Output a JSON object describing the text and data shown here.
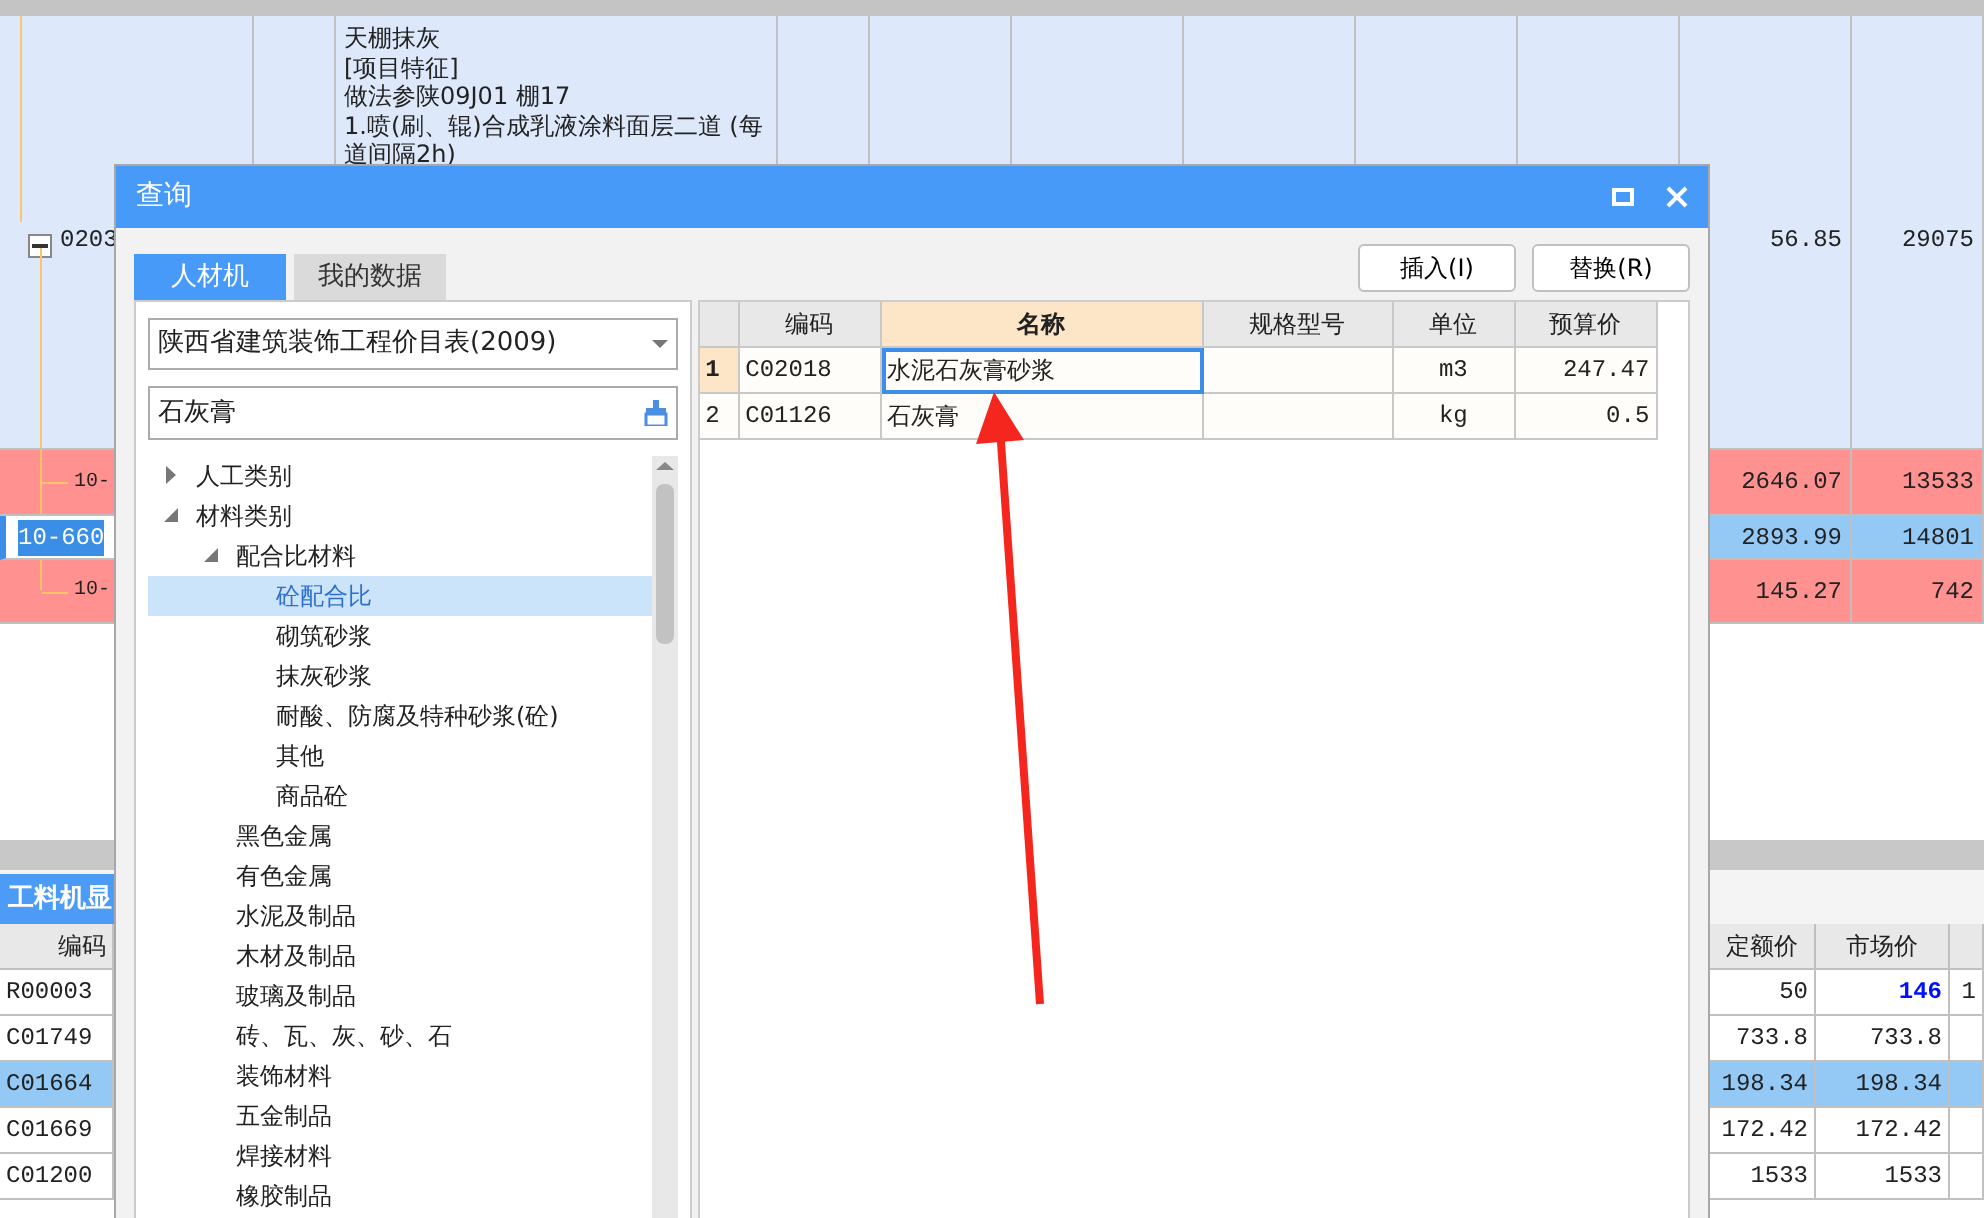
{
  "estimate_sheet": {
    "rows": [
      {
        "code": "0203",
        "expanded": true,
        "editing": false,
        "color": "#dde9fb",
        "description_lines": [
          "天棚抹灰",
          "[项目特征]",
          "做法参陕09J01 棚17",
          "1.喷(刷、辊)合成乳液涂料面层二道 (每",
          "道间隔2h)"
        ],
        "values": [
          "56.85",
          "29075"
        ]
      },
      {
        "code": "10-",
        "editing": false,
        "color": "#ff9191",
        "values": [
          "2646.07",
          "13533"
        ]
      },
      {
        "code": "10-660",
        "editing": true,
        "color": "#94c8f5",
        "values": [
          "2893.99",
          "14801"
        ]
      },
      {
        "code": "10-",
        "editing": false,
        "color": "#ff9191",
        "values": [
          "145.27",
          "742"
        ]
      }
    ]
  },
  "resource_panel": {
    "title": "工料机显",
    "columns": [
      "编码",
      "定额价",
      "市场价"
    ],
    "rows": [
      {
        "code": "R00003",
        "quota_price": "50",
        "market_price": "146",
        "column_5": "1",
        "emphasized": true,
        "selected": false
      },
      {
        "code": "C01749",
        "quota_price": "733.8",
        "market_price": "733.8",
        "emphasized": false,
        "selected": false
      },
      {
        "code": "C01664",
        "quota_price": "198.34",
        "market_price": "198.34",
        "emphasized": false,
        "selected": true
      },
      {
        "code": "C01669",
        "quota_price": "172.42",
        "market_price": "172.42",
        "emphasized": false,
        "selected": false
      },
      {
        "code": "C01200",
        "quota_price": "1533",
        "market_price": "1533",
        "emphasized": false,
        "selected": false
      }
    ]
  },
  "dialog": {
    "title": "查询",
    "tabs": [
      {
        "label": "人材机",
        "selected": true
      },
      {
        "label": "我的数据",
        "selected": false
      }
    ],
    "buttons": [
      "插入(I)",
      "替换(R)"
    ],
    "library": "陕西省建筑装饰工程价目表(2009)",
    "search": "石灰膏",
    "tree": [
      {
        "label": "人工类别",
        "expanded": false,
        "selected": false
      },
      {
        "label": "材料类别",
        "expanded": true,
        "selected": false,
        "children": [
          {
            "label": "配合比材料",
            "expanded": true,
            "selected": false,
            "children": [
              {
                "label": "砼配合比",
                "selected": true
              },
              {
                "label": "砌筑砂浆",
                "selected": false
              },
              {
                "label": "抹灰砂浆",
                "selected": false
              },
              {
                "label": "耐酸、防腐及特种砂浆(砼)",
                "selected": false
              },
              {
                "label": "其他",
                "selected": false
              },
              {
                "label": "商品砼",
                "selected": false
              }
            ]
          },
          {
            "label": "黑色金属",
            "selected": false
          },
          {
            "label": "有色金属",
            "selected": false
          },
          {
            "label": "水泥及制品",
            "selected": false
          },
          {
            "label": "木材及制品",
            "selected": false
          },
          {
            "label": "玻璃及制品",
            "selected": false
          },
          {
            "label": "砖、瓦、灰、砂、石",
            "selected": false
          },
          {
            "label": "装饰材料",
            "selected": false
          },
          {
            "label": "五金制品",
            "selected": false
          },
          {
            "label": "焊接材料",
            "selected": false
          },
          {
            "label": "橡胶制品",
            "selected": false
          }
        ]
      }
    ],
    "results": {
      "columns": [
        {
          "label": "编码",
          "selected": false
        },
        {
          "label": "名称",
          "selected": true
        },
        {
          "label": "规格型号",
          "selected": false
        },
        {
          "label": "单位",
          "selected": false
        },
        {
          "label": "预算价",
          "selected": false
        }
      ],
      "rows": [
        {
          "number": "1",
          "code": "C02018",
          "name": "水泥石灰膏砂浆",
          "unit": "m3",
          "price": "247.47",
          "selected": true
        },
        {
          "number": "2",
          "code": "C01126",
          "name": "石灰膏",
          "unit": "kg",
          "price": "0.5",
          "selected": false
        }
      ]
    }
  }
}
